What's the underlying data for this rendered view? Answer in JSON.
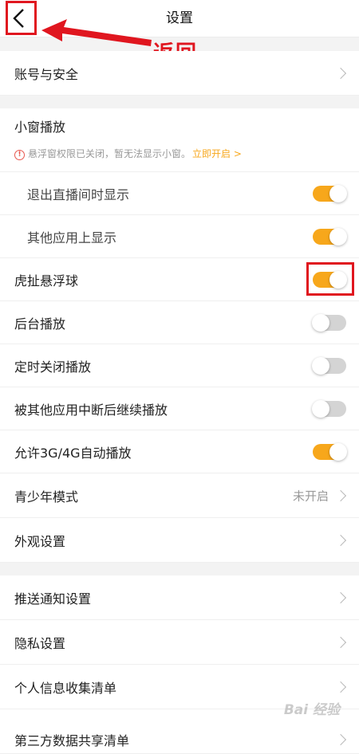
{
  "header": {
    "title": "设置"
  },
  "annotation": {
    "back_label": "返回"
  },
  "rows": {
    "account": "账号与安全",
    "mini_window": "小窗播放",
    "mini_warning": "悬浮窗权限已关闭，暂无法显示小窗。",
    "mini_warning_link": "立即开启 >",
    "exit_live": "退出直播间时显示",
    "other_apps": "其他应用上显示",
    "float_ball": "虎扯悬浮球",
    "background": "后台播放",
    "timer_close": "定时关闭播放",
    "resume_play": "被其他应用中断后继续播放",
    "auto_play": "允许3G/4G自动播放",
    "teen_mode": "青少年模式",
    "teen_mode_value": "未开启",
    "appearance": "外观设置",
    "push": "推送通知设置",
    "privacy": "隐私设置",
    "personal_info": "个人信息收集清单",
    "third_party": "第三方数据共享清单"
  },
  "toggles": {
    "exit_live": true,
    "other_apps": true,
    "float_ball": true,
    "background": false,
    "timer_close": false,
    "resume_play": false,
    "auto_play": true
  },
  "colors": {
    "accent": "#f7a71b",
    "highlight": "#e0161f",
    "toggle_off": "#d4d4d4"
  },
  "watermark": "Bai 经验"
}
